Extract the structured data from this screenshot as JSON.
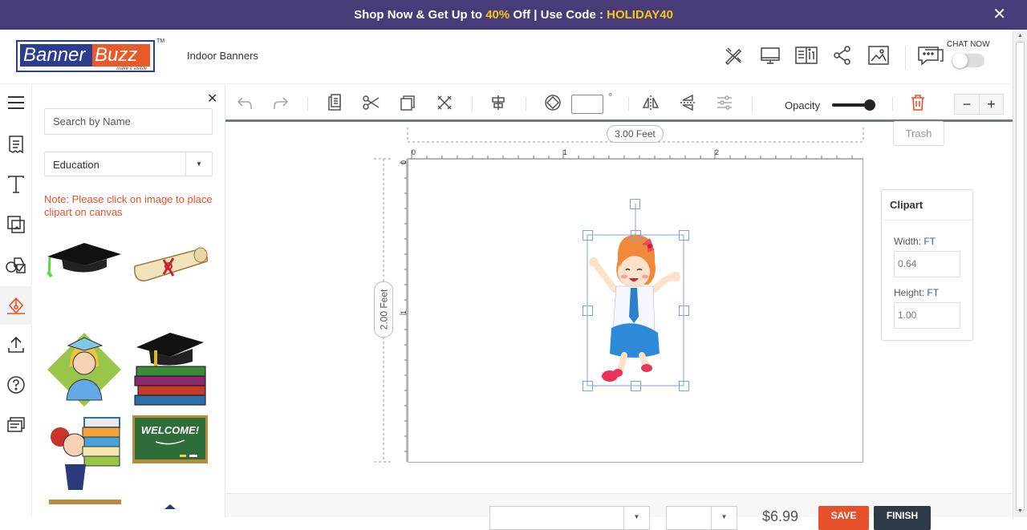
{
  "promo": {
    "text_before": "Shop Now & Get Up to ",
    "percent": "40%",
    "text_mid": " Off | Use Code : ",
    "code": "HOLIDAY40",
    "close": "✕"
  },
  "header": {
    "logo_banner": "Banner",
    "logo_buzz": "Buzz",
    "logo_tagline": "make it visible",
    "trademark": "TM",
    "product_name": "Indoor Banners",
    "chat_label": "CHAT NOW",
    "icons": [
      "design-tools-icon",
      "preview-monitor-icon",
      "guide-book-icon",
      "share-icon",
      "image-icon",
      "chat-icon"
    ]
  },
  "left_rail": {
    "icons": [
      "menu-icon",
      "templates-icon",
      "text-icon",
      "backgrounds-icon",
      "shapes-icon",
      "clipart-icon",
      "upload-icon",
      "help-icon",
      "reviews-icon"
    ]
  },
  "clipart_panel": {
    "close": "✕",
    "search_placeholder": "Search by Name",
    "category": "Education",
    "note": "Note: Please click on image to place clipart on canvas",
    "items": [
      "graduation-cap",
      "diploma-scroll",
      "graduate-girl",
      "books-with-cap",
      "girl-with-books",
      "welcome-chalkboard"
    ]
  },
  "toolbar": {
    "rotation_value": "",
    "degree_symbol": "°",
    "opacity_label": "Opacity",
    "opacity": 1.0,
    "trash_tooltip": "Trash",
    "zoom_out": "−",
    "zoom_in": "+"
  },
  "canvas": {
    "width_label": "3.00 Feet",
    "height_label": "2.00 Feet",
    "h_ruler_ticks": [
      "0",
      "1",
      "2"
    ],
    "v_ruler_ticks": [
      "0",
      "1"
    ]
  },
  "clipart_props": {
    "title": "Clipart",
    "width_label": "Width: ",
    "width_unit": "FT",
    "width_value": "0.64",
    "height_label": "Height: ",
    "height_unit": "FT",
    "height_value": "1.00"
  },
  "footer": {
    "price": "$6.99",
    "save": "SAVE",
    "finish": "FINISH"
  },
  "colors": {
    "promo_bg": "#473c77",
    "promo_highlight": "#f5c518",
    "accent_orange": "#e8502c",
    "brand_blue": "#2c3c8f",
    "finish_bg": "#2e3a48"
  }
}
